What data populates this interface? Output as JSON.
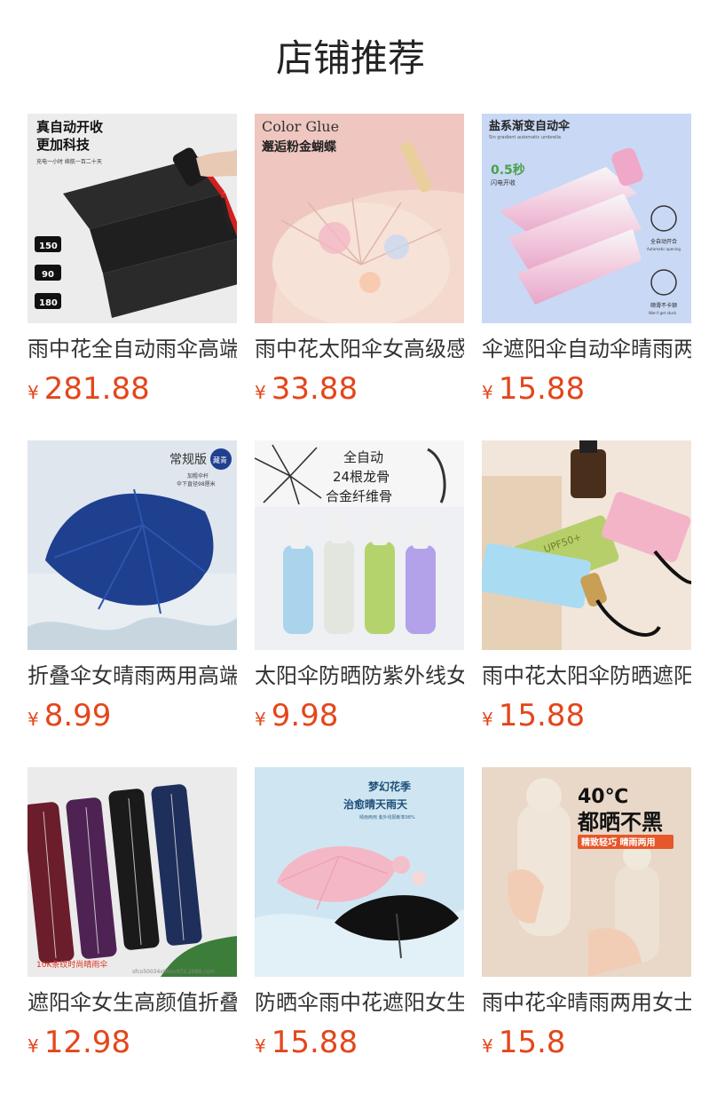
{
  "page": {
    "title": "店铺推荐"
  },
  "currency": "¥",
  "products": [
    {
      "name": "雨中花全自动雨伞高端",
      "price": "281.88",
      "overlay": {
        "l1": "真自动开收",
        "l2": "更加科技",
        "l3": "充电一小时 续航一百二十天",
        "b1": "150",
        "b2": "90",
        "b3": "180"
      }
    },
    {
      "name": "雨中花太阳伞女高级感",
      "price": "33.88",
      "overlay": {
        "l1": "Color Glue",
        "l2": "邂逅粉金蝴蝶"
      }
    },
    {
      "name": "伞遮阳伞自动伞晴雨两用",
      "price": "15.88",
      "overlay": {
        "l1": "盐系渐变自动伞",
        "l2": "5in gradient automatic umbrella",
        "l3": "0.5秒",
        "l4": "闪电开收",
        "l5": "全自动开合",
        "l6": "Automatic opening",
        "l7": "顺滑不卡顿",
        "l8": "Won't get stuck"
      }
    },
    {
      "name": "折叠伞女晴雨两用高端",
      "price": "8.99",
      "overlay": {
        "l1": "常规版",
        "l2": "藏青",
        "l3": "加粗伞杆",
        "l4": "伞下直径98厘米"
      }
    },
    {
      "name": "太阳伞防晒防紫外线女",
      "price": "9.98",
      "overlay": {
        "l1": "全自动",
        "l2": "24根龙骨",
        "l3": "合金纤维骨"
      }
    },
    {
      "name": "雨中花太阳伞防晒遮阳",
      "price": "15.88",
      "overlay": {
        "l1": "UPF50+"
      }
    },
    {
      "name": "遮阳伞女生高颜值折叠",
      "price": "12.98",
      "overlay": {
        "l1": "10K条纹时尚晴雨伞",
        "l2": "sfco50034x86xv972.2688.com"
      }
    },
    {
      "name": "防晒伞雨中花遮阳女生",
      "price": "15.88",
      "overlay": {
        "l1": "梦幻花季",
        "l2": "治愈晴天雨天",
        "l3": "晴雨两用 紫外线隔断率98%"
      }
    },
    {
      "name": "雨中花伞晴雨两用女士",
      "price": "15.8",
      "overlay": {
        "l1": "40℃",
        "l2": "都晒不黑",
        "l3": "精致轻巧 晴雨两用"
      }
    }
  ]
}
